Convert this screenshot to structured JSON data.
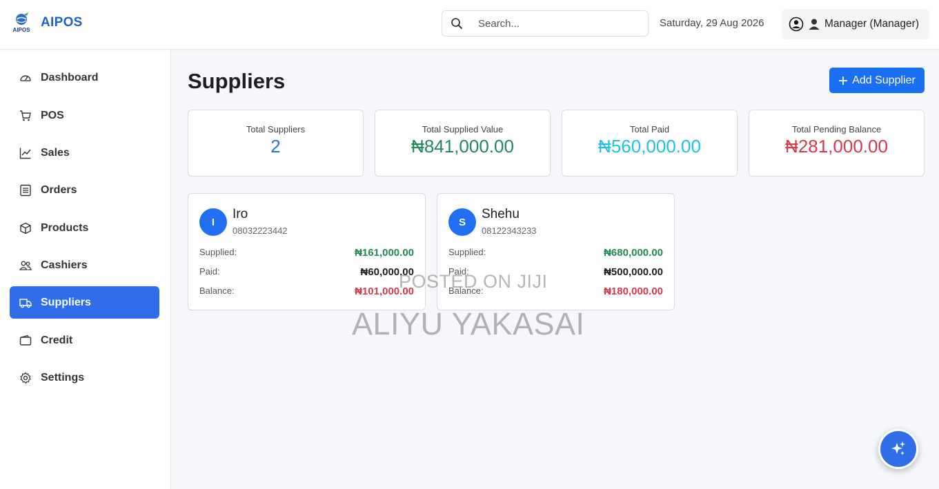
{
  "brand": {
    "name": "AIPOS",
    "logo_text": "AIPOS"
  },
  "header": {
    "search_placeholder": "Search...",
    "date": "Saturday, 29 Aug 2026",
    "user_label": "Manager (Manager)"
  },
  "sidebar": {
    "items": [
      {
        "label": "Dashboard",
        "icon": "gauge-icon"
      },
      {
        "label": "POS",
        "icon": "cart-icon"
      },
      {
        "label": "Sales",
        "icon": "chart-line-icon"
      },
      {
        "label": "Orders",
        "icon": "list-icon"
      },
      {
        "label": "Products",
        "icon": "box-icon"
      },
      {
        "label": "Cashiers",
        "icon": "people-icon"
      },
      {
        "label": "Suppliers",
        "icon": "truck-icon",
        "active": true
      },
      {
        "label": "Credit",
        "icon": "wallet-icon"
      },
      {
        "label": "Settings",
        "icon": "gear-icon"
      }
    ]
  },
  "page": {
    "title": "Suppliers",
    "add_button": "Add Supplier"
  },
  "stats": [
    {
      "label": "Total Suppliers",
      "value": "2",
      "color": "#2f6ee8"
    },
    {
      "label": "Total Supplied Value",
      "value": "₦841,000.00",
      "color": "#1f8a55"
    },
    {
      "label": "Total Paid",
      "value": "₦560,000.00",
      "color": "#1cc3e0"
    },
    {
      "label": "Total Pending Balance",
      "value": "₦281,000.00",
      "color": "#d63a48"
    }
  ],
  "suppliers": [
    {
      "initial": "I",
      "name": "Iro",
      "phone": "08032223442",
      "supplied_label": "Supplied:",
      "supplied": "₦161,000.00",
      "paid_label": "Paid:",
      "paid": "₦60,000.00",
      "balance_label": "Balance:",
      "balance": "₦101,000.00"
    },
    {
      "initial": "S",
      "name": "Shehu",
      "phone": "08122343233",
      "supplied_label": "Supplied:",
      "supplied": "₦680,000.00",
      "paid_label": "Paid:",
      "paid": "₦500,000.00",
      "balance_label": "Balance:",
      "balance": "₦180,000.00"
    }
  ],
  "colors": {
    "supplied": "#1f8a55",
    "paid": "#1c1e21",
    "balance": "#d63a48",
    "accent": "#2f6ee8"
  },
  "watermark": {
    "line1": "POSTED ON JIJI",
    "line2": "ALIYU YAKASAI"
  }
}
